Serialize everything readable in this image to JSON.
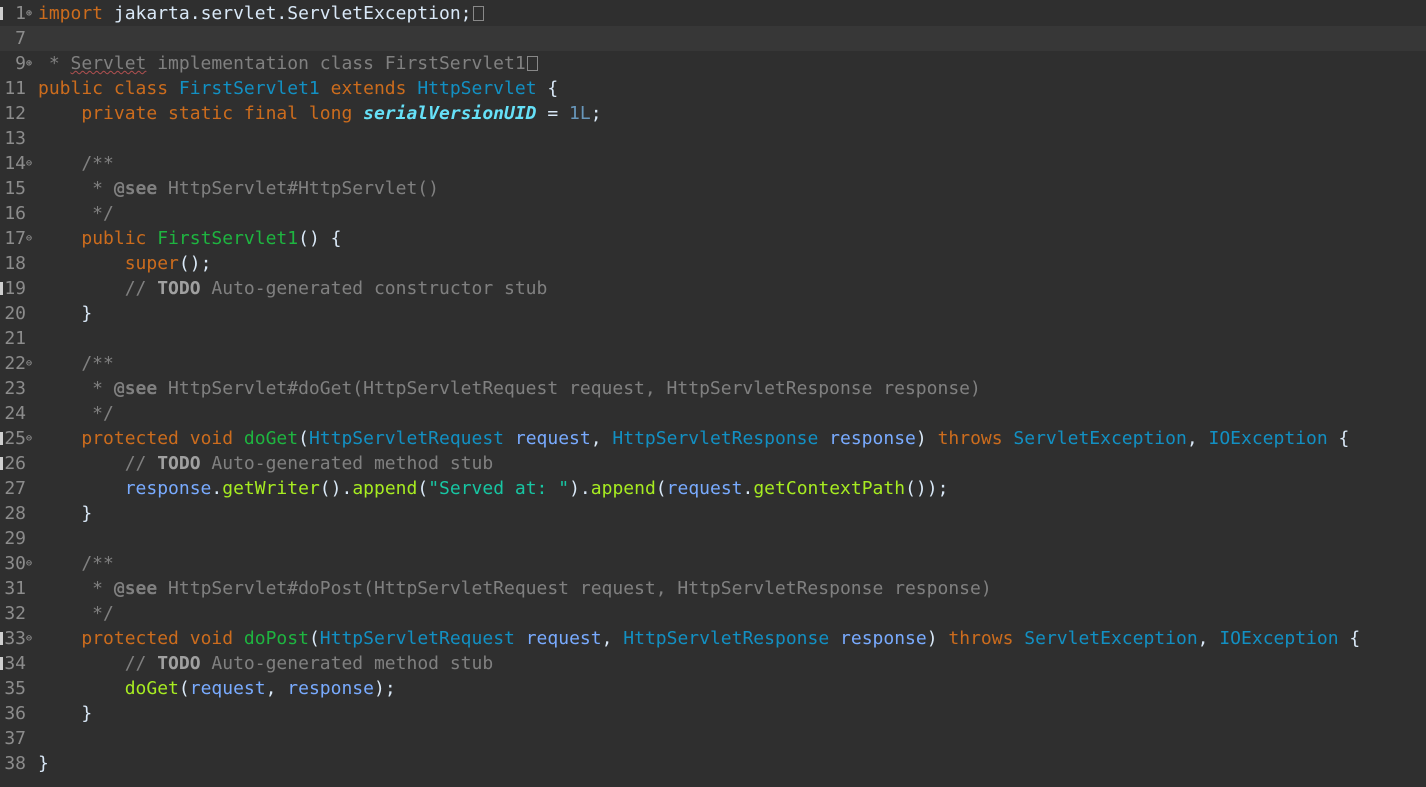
{
  "editor": {
    "lines": [
      {
        "num": "1",
        "fold": "⊕",
        "mark": true,
        "tokens": [
          {
            "t": "import",
            "c": "kw"
          },
          {
            "t": " jakarta.servlet.ServletException;"
          },
          {
            "box": true
          }
        ]
      },
      {
        "num": "7",
        "current": true,
        "tokens": []
      },
      {
        "num": "9",
        "fold": "⊕",
        "tokens": [
          {
            "t": " * ",
            "c": "cmt"
          },
          {
            "t": "Servlet",
            "c": "cmt spell"
          },
          {
            "t": " implementation class FirstServlet1",
            "c": "cmt"
          },
          {
            "box": true
          }
        ]
      },
      {
        "num": "11",
        "tokens": [
          {
            "t": "public class ",
            "c": "kw"
          },
          {
            "t": "FirstServlet1",
            "c": "cls"
          },
          {
            "t": " extends ",
            "c": "kw"
          },
          {
            "t": "HttpServlet",
            "c": "cls"
          },
          {
            "t": " {"
          }
        ]
      },
      {
        "num": "12",
        "tokens": [
          {
            "t": "    "
          },
          {
            "t": "private static final long ",
            "c": "kw"
          },
          {
            "t": "serialVersionUID",
            "c": "field"
          },
          {
            "t": " = "
          },
          {
            "t": "1L",
            "c": "num"
          },
          {
            "t": ";"
          }
        ]
      },
      {
        "num": "13",
        "tokens": []
      },
      {
        "num": "14",
        "fold": "⊖",
        "tokens": [
          {
            "t": "    /**",
            "c": "cmt"
          }
        ]
      },
      {
        "num": "15",
        "tokens": [
          {
            "t": "     * ",
            "c": "cmt"
          },
          {
            "t": "@see",
            "c": "tag"
          },
          {
            "t": " HttpServlet#HttpServlet()",
            "c": "cmt"
          }
        ]
      },
      {
        "num": "16",
        "tokens": [
          {
            "t": "     */",
            "c": "cmt"
          }
        ]
      },
      {
        "num": "17",
        "fold": "⊖",
        "tokens": [
          {
            "t": "    "
          },
          {
            "t": "public ",
            "c": "kw"
          },
          {
            "t": "FirstServlet1",
            "c": "method"
          },
          {
            "t": "() {"
          }
        ]
      },
      {
        "num": "18",
        "tokens": [
          {
            "t": "        "
          },
          {
            "t": "super",
            "c": "kw"
          },
          {
            "t": "();"
          }
        ]
      },
      {
        "num": "19",
        "mark": true,
        "tokens": [
          {
            "t": "        // ",
            "c": "cmt"
          },
          {
            "t": "TODO",
            "c": "todo"
          },
          {
            "t": " Auto-generated constructor stub",
            "c": "cmt"
          }
        ]
      },
      {
        "num": "20",
        "tokens": [
          {
            "t": "    }"
          }
        ]
      },
      {
        "num": "21",
        "tokens": []
      },
      {
        "num": "22",
        "fold": "⊖",
        "tokens": [
          {
            "t": "    /**",
            "c": "cmt"
          }
        ]
      },
      {
        "num": "23",
        "tokens": [
          {
            "t": "     * ",
            "c": "cmt"
          },
          {
            "t": "@see",
            "c": "tag"
          },
          {
            "t": " HttpServlet#doGet(HttpServletRequest request, HttpServletResponse response)",
            "c": "cmt"
          }
        ]
      },
      {
        "num": "24",
        "tokens": [
          {
            "t": "     */",
            "c": "cmt"
          }
        ]
      },
      {
        "num": "25",
        "fold": "⊖",
        "mark": true,
        "tokens": [
          {
            "t": "    "
          },
          {
            "t": "protected void ",
            "c": "kw"
          },
          {
            "t": "doGet",
            "c": "method"
          },
          {
            "t": "("
          },
          {
            "t": "HttpServletRequest",
            "c": "cls"
          },
          {
            "t": " "
          },
          {
            "t": "request",
            "c": "var"
          },
          {
            "t": ", "
          },
          {
            "t": "HttpServletResponse",
            "c": "cls"
          },
          {
            "t": " "
          },
          {
            "t": "response",
            "c": "var"
          },
          {
            "t": ") "
          },
          {
            "t": "throws ",
            "c": "kw"
          },
          {
            "t": "ServletException",
            "c": "cls"
          },
          {
            "t": ", "
          },
          {
            "t": "IOException",
            "c": "cls"
          },
          {
            "t": " {"
          }
        ]
      },
      {
        "num": "26",
        "mark": true,
        "tokens": [
          {
            "t": "        // ",
            "c": "cmt"
          },
          {
            "t": "TODO",
            "c": "todo"
          },
          {
            "t": " Auto-generated method stub",
            "c": "cmt"
          }
        ]
      },
      {
        "num": "27",
        "tokens": [
          {
            "t": "        "
          },
          {
            "t": "response",
            "c": "var"
          },
          {
            "t": "."
          },
          {
            "t": "getWriter",
            "c": "call"
          },
          {
            "t": "()."
          },
          {
            "t": "append",
            "c": "call"
          },
          {
            "t": "("
          },
          {
            "t": "\"Served at: \"",
            "c": "str"
          },
          {
            "t": ")."
          },
          {
            "t": "append",
            "c": "call"
          },
          {
            "t": "("
          },
          {
            "t": "request",
            "c": "var"
          },
          {
            "t": "."
          },
          {
            "t": "getContextPath",
            "c": "call"
          },
          {
            "t": "());"
          }
        ]
      },
      {
        "num": "28",
        "tokens": [
          {
            "t": "    }"
          }
        ]
      },
      {
        "num": "29",
        "tokens": []
      },
      {
        "num": "30",
        "fold": "⊖",
        "tokens": [
          {
            "t": "    /**",
            "c": "cmt"
          }
        ]
      },
      {
        "num": "31",
        "tokens": [
          {
            "t": "     * ",
            "c": "cmt"
          },
          {
            "t": "@see",
            "c": "tag"
          },
          {
            "t": " HttpServlet#doPost(HttpServletRequest request, HttpServletResponse response)",
            "c": "cmt"
          }
        ]
      },
      {
        "num": "32",
        "tokens": [
          {
            "t": "     */",
            "c": "cmt"
          }
        ]
      },
      {
        "num": "33",
        "fold": "⊖",
        "mark": true,
        "tokens": [
          {
            "t": "    "
          },
          {
            "t": "protected void ",
            "c": "kw"
          },
          {
            "t": "doPost",
            "c": "method"
          },
          {
            "t": "("
          },
          {
            "t": "HttpServletRequest",
            "c": "cls"
          },
          {
            "t": " "
          },
          {
            "t": "request",
            "c": "var"
          },
          {
            "t": ", "
          },
          {
            "t": "HttpServletResponse",
            "c": "cls"
          },
          {
            "t": " "
          },
          {
            "t": "response",
            "c": "var"
          },
          {
            "t": ") "
          },
          {
            "t": "throws ",
            "c": "kw"
          },
          {
            "t": "ServletException",
            "c": "cls"
          },
          {
            "t": ", "
          },
          {
            "t": "IOException",
            "c": "cls"
          },
          {
            "t": " {"
          }
        ]
      },
      {
        "num": "34",
        "mark": true,
        "tokens": [
          {
            "t": "        // ",
            "c": "cmt"
          },
          {
            "t": "TODO",
            "c": "todo"
          },
          {
            "t": " Auto-generated method stub",
            "c": "cmt"
          }
        ]
      },
      {
        "num": "35",
        "tokens": [
          {
            "t": "        "
          },
          {
            "t": "doGet",
            "c": "call"
          },
          {
            "t": "("
          },
          {
            "t": "request",
            "c": "var"
          },
          {
            "t": ", "
          },
          {
            "t": "response",
            "c": "var"
          },
          {
            "t": ");"
          }
        ]
      },
      {
        "num": "36",
        "tokens": [
          {
            "t": "    }"
          }
        ]
      },
      {
        "num": "37",
        "tokens": []
      },
      {
        "num": "38",
        "tokens": [
          {
            "t": "}"
          }
        ]
      }
    ]
  }
}
